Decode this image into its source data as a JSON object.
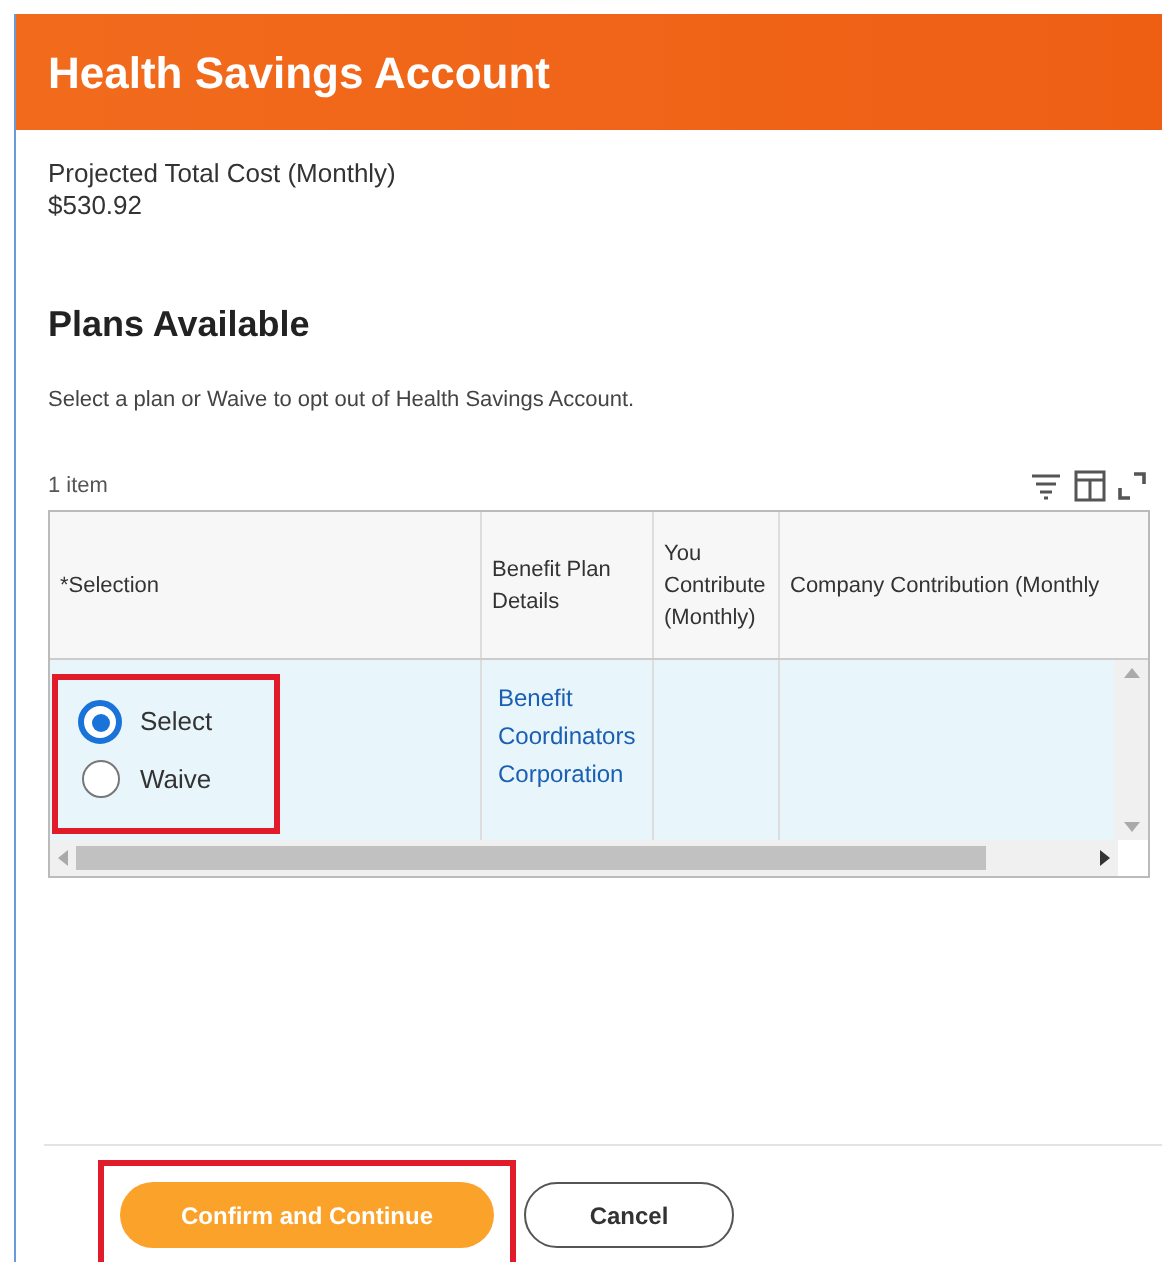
{
  "header": {
    "title": "Health Savings Account"
  },
  "summary": {
    "label": "Projected Total Cost (Monthly)",
    "value": "$530.92"
  },
  "section": {
    "title": "Plans Available",
    "instructions": "Select a plan or Waive to opt out of Health Savings Account."
  },
  "table": {
    "count": "1 item",
    "columns": [
      "*Selection",
      "Benefit Plan Details",
      "You Contribute (Monthly)",
      "Company Contribution (Monthly"
    ],
    "rows": [
      {
        "options": [
          {
            "label": "Select",
            "selected": true
          },
          {
            "label": "Waive",
            "selected": false
          }
        ],
        "plan": "Benefit Coordinators Corporation"
      }
    ]
  },
  "buttons": [
    {
      "label": "Confirm and Continue",
      "kind": "primary"
    },
    {
      "label": "Cancel",
      "kind": "secondary"
    }
  ]
}
